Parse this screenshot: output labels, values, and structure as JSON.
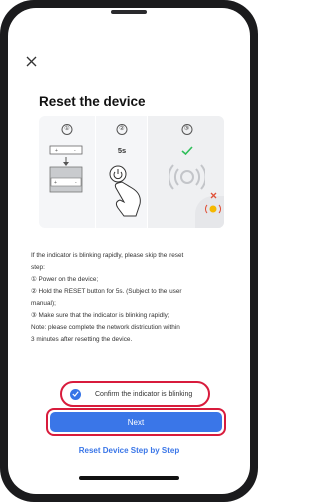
{
  "header": {
    "title": "Reset the device"
  },
  "illustration": {
    "steps": [
      "①",
      "②",
      "③"
    ],
    "hold_duration": "5s"
  },
  "instructions": {
    "lines": [
      "If the indicator is blinking rapidly, please skip the reset",
      "step:",
      "① Power on the device;",
      "② Hold the RESET button for 5s. (Subject to the user",
      "manual);",
      "③ Make sure that the indicator is blinking rapidly;",
      "Note: please complete the network districution within",
      "3 minutes after resetting the device."
    ]
  },
  "confirm": {
    "label": "Confirm the indicator is blinking",
    "checked": true
  },
  "actions": {
    "next_label": "Next",
    "link_label": "Reset Device Step by Step"
  },
  "colors": {
    "accent": "#3a76e8",
    "highlight": "#d81b3c",
    "success": "#2fbf5a",
    "error": "#e0523a",
    "indicator": "#f5b800"
  }
}
